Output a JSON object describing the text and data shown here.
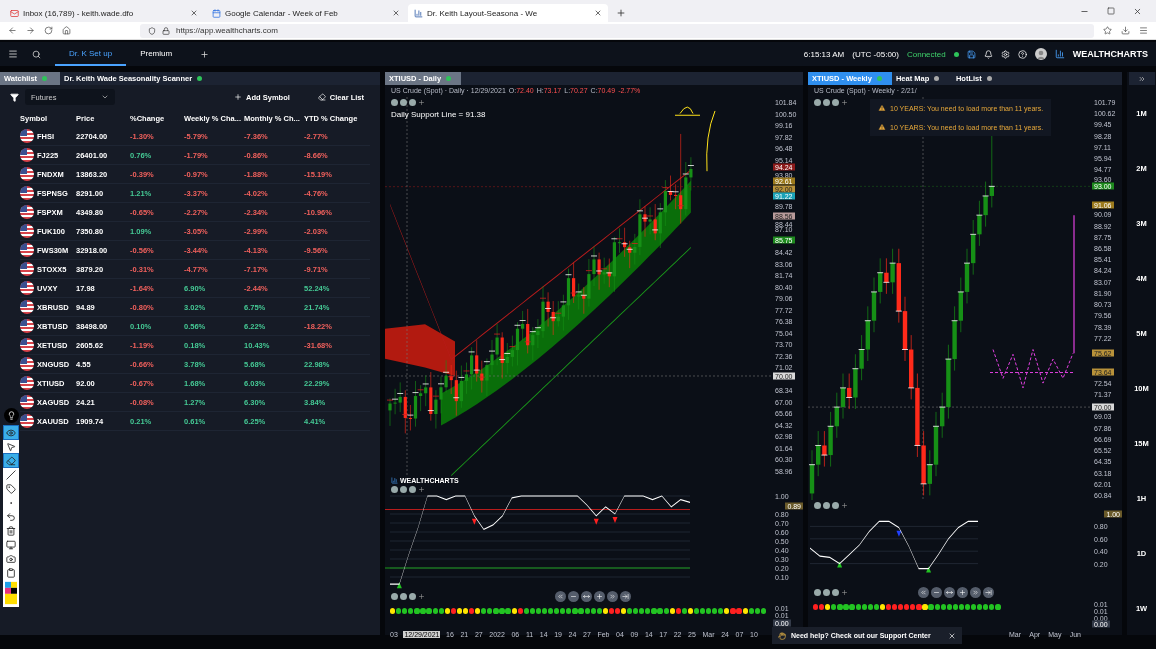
{
  "browser": {
    "tabs": [
      {
        "title": "Inbox (16,789) - keith.wade.dfo",
        "selected": false,
        "kind": "mail"
      },
      {
        "title": "Google Calendar - Week of Feb",
        "selected": false,
        "kind": "calendar"
      },
      {
        "title": "Dr. Keith Layout-Seasona - We",
        "selected": true,
        "kind": "chart"
      }
    ],
    "address": "https://app.wealthcharts.com"
  },
  "header": {
    "layouts": [
      {
        "label": "Dr. K Set up",
        "selected": true
      },
      {
        "label": "Premium",
        "selected": false
      }
    ],
    "time": "6:15:13 AM",
    "timezone": "(UTC -05:00)",
    "status": "Connected",
    "brand": "WEALTHCHARTS"
  },
  "watchlist": {
    "tabs": [
      {
        "label": "Watchlist",
        "selected": true
      },
      {
        "label": "Dr. Keith Wade Seasonality Scanner",
        "selected": false
      }
    ],
    "filter": "Futures",
    "add_symbol": "Add Symbol",
    "clear_list": "Clear List",
    "columns": [
      "Symbol",
      "Price",
      "%Change",
      "Weekly % Cha...",
      "Monthly % Ch...",
      "YTD % Change"
    ],
    "rows": [
      {
        "symbol": "FHSI",
        "price": "22704.00",
        "changes": [
          {
            "value": "-1.30%",
            "negative": true
          },
          {
            "value": "-5.79%",
            "negative": true
          },
          {
            "value": "-7.36%",
            "negative": true
          },
          {
            "value": "-2.77%",
            "negative": true
          }
        ]
      },
      {
        "symbol": "FJ225",
        "price": "26401.00",
        "changes": [
          {
            "value": "0.76%",
            "negative": false
          },
          {
            "value": "-1.79%",
            "negative": true
          },
          {
            "value": "-0.86%",
            "negative": true
          },
          {
            "value": "-8.66%",
            "negative": true
          }
        ]
      },
      {
        "symbol": "FNDXM",
        "price": "13863.20",
        "changes": [
          {
            "value": "-0.39%",
            "negative": true
          },
          {
            "value": "-0.97%",
            "negative": true
          },
          {
            "value": "-1.88%",
            "negative": true
          },
          {
            "value": "-15.19%",
            "negative": true
          }
        ]
      },
      {
        "symbol": "FSPNSG",
        "price": "8291.00",
        "changes": [
          {
            "value": "1.21%",
            "negative": false
          },
          {
            "value": "-3.37%",
            "negative": true
          },
          {
            "value": "-4.02%",
            "negative": true
          },
          {
            "value": "-4.76%",
            "negative": true
          }
        ]
      },
      {
        "symbol": "FSPXM",
        "price": "4349.80",
        "changes": [
          {
            "value": "-0.65%",
            "negative": true
          },
          {
            "value": "-2.27%",
            "negative": true
          },
          {
            "value": "-2.34%",
            "negative": true
          },
          {
            "value": "-10.96%",
            "negative": true
          }
        ]
      },
      {
        "symbol": "FUK100",
        "price": "7350.80",
        "changes": [
          {
            "value": "1.09%",
            "negative": false
          },
          {
            "value": "-3.05%",
            "negative": true
          },
          {
            "value": "-2.99%",
            "negative": true
          },
          {
            "value": "-2.03%",
            "negative": true
          }
        ]
      },
      {
        "symbol": "FWS30M",
        "price": "32918.00",
        "changes": [
          {
            "value": "-0.56%",
            "negative": true
          },
          {
            "value": "-3.44%",
            "negative": true
          },
          {
            "value": "-4.13%",
            "negative": true
          },
          {
            "value": "-9.56%",
            "negative": true
          }
        ]
      },
      {
        "symbol": "STOXX5",
        "price": "3879.20",
        "changes": [
          {
            "value": "-0.31%",
            "negative": true
          },
          {
            "value": "-4.77%",
            "negative": true
          },
          {
            "value": "-7.17%",
            "negative": true
          },
          {
            "value": "-9.71%",
            "negative": true
          }
        ]
      },
      {
        "symbol": "UVXY",
        "price": "17.98",
        "changes": [
          {
            "value": "-1.64%",
            "negative": true
          },
          {
            "value": "6.90%",
            "negative": false
          },
          {
            "value": "-2.44%",
            "negative": true
          },
          {
            "value": "52.24%",
            "negative": false
          }
        ]
      },
      {
        "symbol": "XBRUSD",
        "price": "94.89",
        "changes": [
          {
            "value": "-0.80%",
            "negative": true
          },
          {
            "value": "3.02%",
            "negative": false
          },
          {
            "value": "6.75%",
            "negative": false
          },
          {
            "value": "21.74%",
            "negative": false
          }
        ]
      },
      {
        "symbol": "XBTUSD",
        "price": "38498.00",
        "changes": [
          {
            "value": "0.10%",
            "negative": false
          },
          {
            "value": "0.56%",
            "negative": false
          },
          {
            "value": "6.22%",
            "negative": false
          },
          {
            "value": "-18.22%",
            "negative": true
          }
        ]
      },
      {
        "symbol": "XETUSD",
        "price": "2605.62",
        "changes": [
          {
            "value": "-1.19%",
            "negative": true
          },
          {
            "value": "0.18%",
            "negative": false
          },
          {
            "value": "10.43%",
            "negative": false
          },
          {
            "value": "-31.68%",
            "negative": true
          }
        ]
      },
      {
        "symbol": "XNGUSD",
        "price": "4.55",
        "changes": [
          {
            "value": "-0.66%",
            "negative": true
          },
          {
            "value": "3.78%",
            "negative": false
          },
          {
            "value": "5.68%",
            "negative": false
          },
          {
            "value": "22.98%",
            "negative": false
          }
        ]
      },
      {
        "symbol": "XTIUSD",
        "price": "92.00",
        "changes": [
          {
            "value": "-0.67%",
            "negative": true
          },
          {
            "value": "1.68%",
            "negative": false
          },
          {
            "value": "6.03%",
            "negative": false
          },
          {
            "value": "22.29%",
            "negative": false
          }
        ]
      },
      {
        "symbol": "XAGUSD",
        "price": "24.21",
        "changes": [
          {
            "value": "-0.08%",
            "negative": true
          },
          {
            "value": "1.27%",
            "negative": false
          },
          {
            "value": "6.30%",
            "negative": false
          },
          {
            "value": "3.84%",
            "negative": false
          }
        ]
      },
      {
        "symbol": "XAUUSD",
        "price": "1909.74",
        "changes": [
          {
            "value": "0.21%",
            "negative": false
          },
          {
            "value": "0.61%",
            "negative": false
          },
          {
            "value": "6.25%",
            "negative": false
          },
          {
            "value": "4.41%",
            "negative": false
          }
        ]
      }
    ]
  },
  "tools": [
    {
      "kind": "eye",
      "selected": true
    },
    {
      "kind": "pointer",
      "selected": false
    },
    {
      "kind": "eraser",
      "selected": true
    },
    {
      "kind": "line",
      "selected": false
    },
    {
      "kind": "tag",
      "selected": false
    },
    {
      "kind": "dot",
      "selected": false
    },
    {
      "kind": "undo",
      "selected": false
    },
    {
      "kind": "trash",
      "selected": false
    },
    {
      "kind": "monitor",
      "selected": false
    },
    {
      "kind": "camera",
      "selected": false
    },
    {
      "kind": "clipboard",
      "selected": false
    },
    {
      "kind": "palette",
      "selected": false
    }
  ],
  "chart_left": {
    "tabs": [
      {
        "label": "XTIUSD - Daily",
        "selected": true
      }
    ],
    "legend": {
      "instrument": "US Crude (Spot) · Daily · 12/29/2021",
      "ohlc": [
        {
          "label": "O:",
          "value": "72.40"
        },
        {
          "label": "H:",
          "value": "73.17"
        },
        {
          "label": "L:",
          "value": "70.27"
        },
        {
          "label": "C:",
          "value": "70.49"
        }
      ],
      "change": "-2.77%"
    },
    "note": "Daily Support Line = 91.38",
    "price_axis": [
      "101.84",
      "100.50",
      "99.16",
      "97.82",
      "96.48",
      "95.14",
      "93.80",
      "89.78",
      "88.44",
      "87.10",
      "84.42",
      "83.06",
      "81.74",
      "80.40",
      "79.06",
      "77.72",
      "76.38",
      "75.04",
      "73.70",
      "72.36",
      "71.02",
      "68.34",
      "67.00",
      "65.66",
      "64.32",
      "62.98",
      "61.64",
      "60.30",
      "58.96"
    ],
    "price_tags": [
      {
        "text": "94.24",
        "color": "#8b1a1a"
      },
      {
        "text": "92.61",
        "color": "#9c7a1c"
      },
      {
        "text": "92.00",
        "color": "#b8923a"
      },
      {
        "text": "91.22",
        "color": "#1aa3b8"
      },
      {
        "text": "88.56",
        "color": "#b89a9a"
      },
      {
        "text": "85.75",
        "color": "#1e8a1e"
      },
      {
        "text": "70.00",
        "color": "#d9d9d9"
      }
    ],
    "logo": "WEALTHCHARTS",
    "indicator_axis": [
      "1.00",
      "0.80",
      "0.70",
      "0.60",
      "0.50",
      "0.40",
      "0.30",
      "0.20",
      "0.10"
    ],
    "indicator_tag": "0.89",
    "strip_axis": [
      "0.01",
      "0.01"
    ],
    "strip_tag": "0.00",
    "dots": [
      {
        "color": "#ffe600"
      },
      {
        "color": "#22c322"
      },
      {
        "color": "#22c322"
      },
      {
        "color": "#22c322"
      },
      {
        "color": "#22c322"
      },
      {
        "color": "#22c322"
      },
      {
        "color": "#22c322"
      },
      {
        "color": "#22c322"
      },
      {
        "color": "#22c322"
      },
      {
        "color": "#ffe600"
      },
      {
        "color": "#ff2020"
      },
      {
        "color": "#ffe600"
      },
      {
        "color": "#ffe600"
      },
      {
        "color": "#ff2020"
      },
      {
        "color": "#ffe600"
      },
      {
        "color": "#22c322"
      },
      {
        "color": "#22c322"
      },
      {
        "color": "#22c322"
      },
      {
        "color": "#22c322"
      },
      {
        "color": "#22c322"
      },
      {
        "color": "#ffe600"
      },
      {
        "color": "#ff2020"
      },
      {
        "color": "#22c322"
      },
      {
        "color": "#22c322"
      },
      {
        "color": "#22c322"
      },
      {
        "color": "#22c322"
      },
      {
        "color": "#22c322"
      },
      {
        "color": "#22c322"
      },
      {
        "color": "#22c322"
      },
      {
        "color": "#22c322"
      },
      {
        "color": "#22c322"
      },
      {
        "color": "#22c322"
      },
      {
        "color": "#22c322"
      },
      {
        "color": "#22c322"
      },
      {
        "color": "#22c322"
      },
      {
        "color": "#ffe600"
      },
      {
        "color": "#ff2020"
      },
      {
        "color": "#ff2020"
      },
      {
        "color": "#ffe600"
      },
      {
        "color": "#22c322"
      },
      {
        "color": "#22c322"
      },
      {
        "color": "#22c322"
      },
      {
        "color": "#22c322"
      },
      {
        "color": "#22c322"
      },
      {
        "color": "#22c322"
      },
      {
        "color": "#22c322"
      },
      {
        "color": "#ffe600"
      },
      {
        "color": "#ff2020"
      },
      {
        "color": "#22c322"
      },
      {
        "color": "#ffe600"
      },
      {
        "color": "#22c322"
      },
      {
        "color": "#22c322"
      },
      {
        "color": "#22c322"
      },
      {
        "color": "#22c322"
      },
      {
        "color": "#22c322"
      },
      {
        "color": "#ffe600"
      },
      {
        "color": "#ff2020"
      },
      {
        "color": "#ff2020"
      },
      {
        "color": "#ffe600"
      },
      {
        "color": "#22c322"
      },
      {
        "color": "#22c322"
      },
      {
        "color": "#22c322"
      }
    ],
    "time_axis": [
      {
        "label": "03",
        "selected": false
      },
      {
        "label": "12/29/2021",
        "selected": true
      },
      {
        "label": "16",
        "selected": false
      },
      {
        "label": "21",
        "selected": false
      },
      {
        "label": "27",
        "selected": false
      },
      {
        "label": "2022",
        "selected": false
      },
      {
        "label": "06",
        "selected": false
      },
      {
        "label": "11",
        "selected": false
      },
      {
        "label": "14",
        "selected": false
      },
      {
        "label": "19",
        "selected": false
      },
      {
        "label": "24",
        "selected": false
      },
      {
        "label": "27",
        "selected": false
      },
      {
        "label": "Feb",
        "selected": false
      },
      {
        "label": "04",
        "selected": false
      },
      {
        "label": "09",
        "selected": false
      },
      {
        "label": "14",
        "selected": false
      },
      {
        "label": "17",
        "selected": false
      },
      {
        "label": "22",
        "selected": false
      },
      {
        "label": "25",
        "selected": false
      },
      {
        "label": "Mar",
        "selected": false
      },
      {
        "label": "24",
        "selected": false
      },
      {
        "label": "07",
        "selected": false
      },
      {
        "label": "10",
        "selected": false
      }
    ]
  },
  "chart_right": {
    "tabs": [
      {
        "label": "XTIUSD - Weekly",
        "selected": true
      },
      {
        "label": "Heat Map",
        "selected": false
      },
      {
        "label": "HotList",
        "selected": false
      }
    ],
    "legend": "US Crude (Spot) · Weekly · 2/21/",
    "alerts": [
      "10 YEARS: You need to load more than 11 years.",
      "10 YEARS: You need to load more than 11 years."
    ],
    "price_axis": [
      "101.79",
      "100.62",
      "99.45",
      "98.28",
      "97.11",
      "95.94",
      "94.77",
      "93.60",
      "90.09",
      "88.92",
      "87.75",
      "86.58",
      "85.41",
      "84.24",
      "83.07",
      "81.90",
      "80.73",
      "79.56",
      "78.39",
      "77.22",
      "72.54",
      "71.37",
      "69.03",
      "67.86",
      "66.69",
      "65.52",
      "64.35",
      "63.18",
      "62.01",
      "60.84"
    ],
    "price_tags": [
      {
        "text": "93.00",
        "color": "#1e8a1e"
      },
      {
        "text": "91.06",
        "color": "#9c7a1c"
      },
      {
        "text": "75.62",
        "color": "#b8923a"
      },
      {
        "text": "73.64",
        "color": "#b8923a"
      },
      {
        "text": "70.00",
        "color": "#d9d9d9"
      }
    ],
    "indicator_axis": [
      "0.80",
      "0.60",
      "0.40",
      "0.20"
    ],
    "indicator_tag": "1.00",
    "strip_axis": [
      "0.01",
      "0.01",
      "0.00"
    ],
    "strip_tag": "0.00",
    "dots": [
      {
        "color": "#ff2020"
      },
      {
        "color": "#ff2020"
      },
      {
        "color": "#ffe600"
      },
      {
        "color": "#22c322"
      },
      {
        "color": "#22c322"
      },
      {
        "color": "#22c322"
      },
      {
        "color": "#22c322"
      },
      {
        "color": "#22c322"
      },
      {
        "color": "#22c322"
      },
      {
        "color": "#22c322"
      },
      {
        "color": "#22c322"
      },
      {
        "color": "#ffe600"
      },
      {
        "color": "#ff2020"
      },
      {
        "color": "#ff2020"
      },
      {
        "color": "#ff2020"
      },
      {
        "color": "#ff2020"
      },
      {
        "color": "#ff2020"
      },
      {
        "color": "#ff2020"
      },
      {
        "color": "#ffe600"
      },
      {
        "color": "#22c322"
      },
      {
        "color": "#22c322"
      },
      {
        "color": "#22c322"
      },
      {
        "color": "#22c322"
      },
      {
        "color": "#22c322"
      },
      {
        "color": "#22c322"
      },
      {
        "color": "#22c322"
      },
      {
        "color": "#22c322"
      },
      {
        "color": "#22c322"
      },
      {
        "color": "#22c322"
      },
      {
        "color": "#22c322"
      },
      {
        "color": "#22c322"
      }
    ],
    "time_axis": [
      {
        "label": "Mar",
        "selected": false
      },
      {
        "label": "Apr",
        "selected": false
      },
      {
        "label": "May",
        "selected": false
      },
      {
        "label": "Jun",
        "selected": false
      }
    ]
  },
  "sidebar": {
    "timeframes": [
      "1M",
      "2M",
      "3M",
      "4M",
      "5M",
      "10M",
      "15M",
      "1H",
      "1D",
      "1W"
    ]
  },
  "toast": "Need help? Check out our Support Center"
}
